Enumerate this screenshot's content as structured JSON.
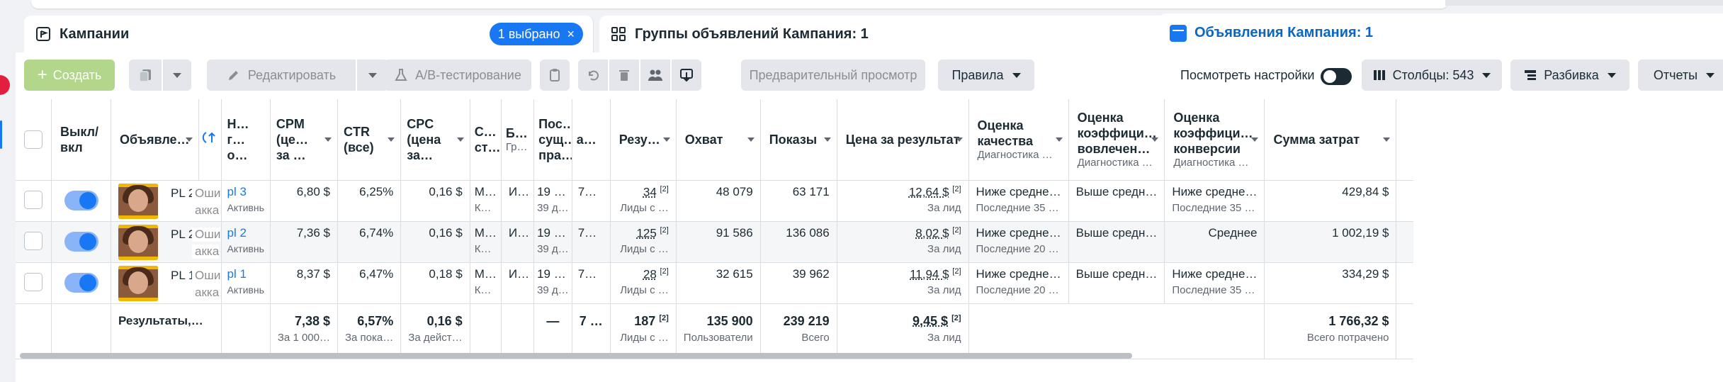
{
  "tabs": {
    "campaigns": {
      "label": "Кампании",
      "badge": "1 выбрано",
      "badge_close": "×"
    },
    "adsets": {
      "label": "Группы объявлений Кампания: 1"
    },
    "ads": {
      "label": "Объявления Кампания: 1"
    }
  },
  "toolbar": {
    "create": "Создать",
    "create_plus": "+",
    "edit": "Редактировать",
    "abtest": "A/B-тестирование",
    "preview": "Предварительный просмотр",
    "rules": "Правила",
    "view_settings": "Посмотреть настройки",
    "columns": "Столбцы: 543",
    "breakdown": "Разбивка",
    "reports": "Отчеты"
  },
  "headers": {
    "onoff": "Выкл/ вкл",
    "ad": "Объявле…",
    "name": "Н… г… о…",
    "cpm": "CPM (це… за …",
    "ctr": "CTR (все)",
    "cpc": "CPC (цена за…",
    "c": "С… ст…",
    "b": "Б…",
    "b_sub": "Гр…",
    "last": "Пос… сущ… пра…",
    "a": "а…",
    "results": "Резу…",
    "reach": "Охват",
    "impressions": "Показы",
    "cost_result": "Цена за результат",
    "quality": "Оценка качества",
    "quality_sub": "Диагностика …",
    "engagement": "Оценка коэффици… вовлечен…",
    "engagement_sub": "Диагностика …",
    "conversion": "Оценка коэффици… конверсии",
    "conversion_sub": "Диагностика …",
    "spent": "Сумма затрат"
  },
  "rows": [
    {
      "ad": "PL 2",
      "err": "Оши",
      "err2": "акка",
      "adset": "pl 3",
      "status": "Активнь",
      "cpm": "6,80 $",
      "ctr": "6,25%",
      "cpc": "0,16 $",
      "c": "М…",
      "c2": "К…",
      "b": "И…",
      "last": "19 …",
      "last2": "39 д…",
      "a": "7…",
      "results": "34",
      "results_sup": "[2]",
      "results_sub": "Лиды с …",
      "reach": "48 079",
      "impressions": "63 171",
      "cost": "12,64 $",
      "cost_sup": "[2]",
      "cost_sub": "За лид",
      "quality": "Ниже средне…",
      "quality_sub": "Последние 35 …",
      "engagement": "Выше средн…",
      "conversion": "Ниже средне…",
      "conversion_sub": "Последние 35 …",
      "spent": "429,84 $"
    },
    {
      "ad": "PL 2",
      "err": "Оши",
      "err2": "акка",
      "adset": "pl 2",
      "status": "Активнь",
      "cpm": "7,36 $",
      "ctr": "6,74%",
      "cpc": "0,16 $",
      "c": "М…",
      "c2": "К…",
      "b": "И…",
      "last": "19 …",
      "last2": "39 д…",
      "a": "7…",
      "results": "125",
      "results_sup": "[2]",
      "results_sub": "Лиды с …",
      "reach": "91 586",
      "impressions": "136 086",
      "cost": "8,02 $",
      "cost_sup": "[2]",
      "cost_sub": "За лид",
      "quality": "Ниже средне…",
      "quality_sub": "Последние 20 …",
      "engagement": "Выше средн…",
      "conversion": "Среднее",
      "conversion_sub": "",
      "spent": "1 002,19 $"
    },
    {
      "ad": "PL 1",
      "err": "Оши",
      "err2": "акка",
      "adset": "pl 1",
      "status": "Активнь",
      "cpm": "8,37 $",
      "ctr": "6,47%",
      "cpc": "0,18 $",
      "c": "М…",
      "c2": "К…",
      "b": "И…",
      "last": "19 …",
      "last2": "39 д…",
      "a": "7…",
      "results": "28",
      "results_sup": "[2]",
      "results_sub": "Лиды с …",
      "reach": "32 615",
      "impressions": "39 962",
      "cost": "11,94 $",
      "cost_sup": "[2]",
      "cost_sub": "За лид",
      "quality": "Ниже средне…",
      "quality_sub": "Последние 20 …",
      "engagement": "Выше средн…",
      "conversion": "Ниже средне…",
      "conversion_sub": "Последние 35 …",
      "spent": "334,29 $"
    }
  ],
  "totals": {
    "label": "Результаты,…",
    "cpm": "7,38 $",
    "cpm_sub": "За 1 000…",
    "ctr": "6,57%",
    "ctr_sub": "За пока…",
    "cpc": "0,16 $",
    "cpc_sub": "За дейст…",
    "last": "—",
    "a": "7 …",
    "results": "187",
    "results_sup": "[2]",
    "results_sub": "Лиды с …",
    "reach": "135 900",
    "reach_sub": "Пользователи",
    "impressions": "239 219",
    "impressions_sub": "Всего",
    "cost": "9,45 $",
    "cost_sup": "[2]",
    "cost_sub": "За лид",
    "spent": "1 766,32 $",
    "spent_sub": "Всего потрачено"
  }
}
